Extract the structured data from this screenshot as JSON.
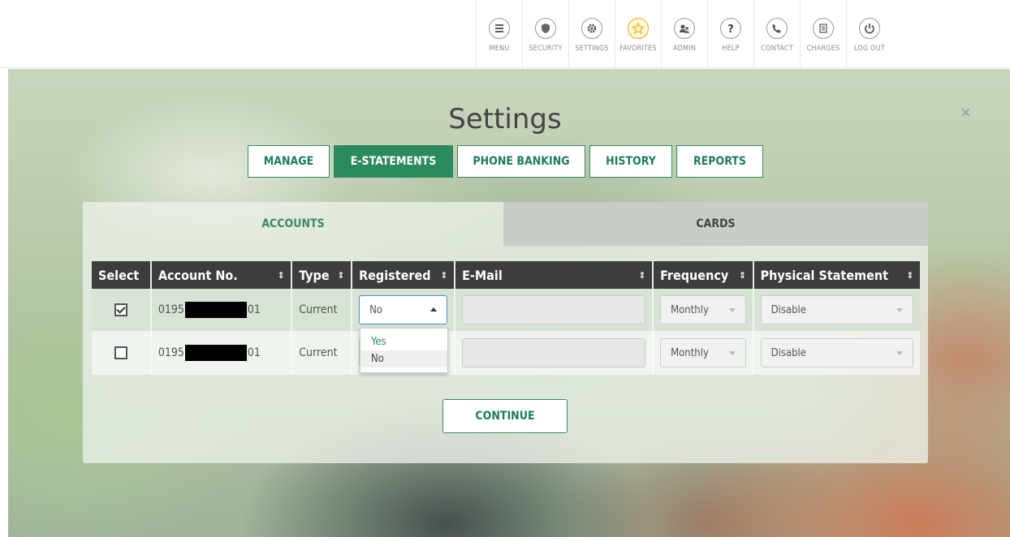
{
  "nav": [
    {
      "id": "menu",
      "label": "MENU",
      "icon": "menu-icon"
    },
    {
      "id": "security",
      "label": "SECURITY",
      "icon": "shield-icon"
    },
    {
      "id": "settings",
      "label": "SETTINGS",
      "icon": "gear-icon"
    },
    {
      "id": "favorites",
      "label": "FAVORITES",
      "icon": "star-icon"
    },
    {
      "id": "admin",
      "label": "ADMIN",
      "icon": "users-icon"
    },
    {
      "id": "help",
      "label": "HELP",
      "icon": "question-icon"
    },
    {
      "id": "contact",
      "label": "CONTACT",
      "icon": "phone-icon"
    },
    {
      "id": "charges",
      "label": "CHARGES",
      "icon": "receipt-icon"
    },
    {
      "id": "logout",
      "label": "LOG OUT",
      "icon": "power-icon"
    }
  ],
  "page": {
    "title": "Settings",
    "close": "×"
  },
  "tabs": [
    {
      "label": "MANAGE",
      "active": false
    },
    {
      "label": "E-STATEMENTS",
      "active": true
    },
    {
      "label": "PHONE BANKING",
      "active": false
    },
    {
      "label": "HISTORY",
      "active": false
    },
    {
      "label": "REPORTS",
      "active": false
    }
  ],
  "subtabs": {
    "accounts": "ACCOUNTS",
    "cards": "CARDS"
  },
  "table": {
    "headers": [
      "Select",
      "Account No.",
      "Type",
      "Registered",
      "E-Mail",
      "Frequency",
      "Physical Statement"
    ],
    "sort_icon": "⇕",
    "rows": [
      {
        "selected": true,
        "account_prefix": "0195",
        "account_suffix": "01",
        "type": "Current",
        "registered": "No",
        "email": "",
        "frequency": "Monthly",
        "physical": "Disable"
      },
      {
        "selected": false,
        "account_prefix": "0195",
        "account_suffix": "01",
        "type": "Current",
        "registered": "No",
        "email": "",
        "frequency": "Monthly",
        "physical": "Disable"
      }
    ]
  },
  "dropdown": {
    "options": [
      "Yes",
      "No"
    ]
  },
  "continue_label": "CONTINUE",
  "colors": {
    "accent": "#2c8a5f",
    "header": "#3d3d3d"
  }
}
